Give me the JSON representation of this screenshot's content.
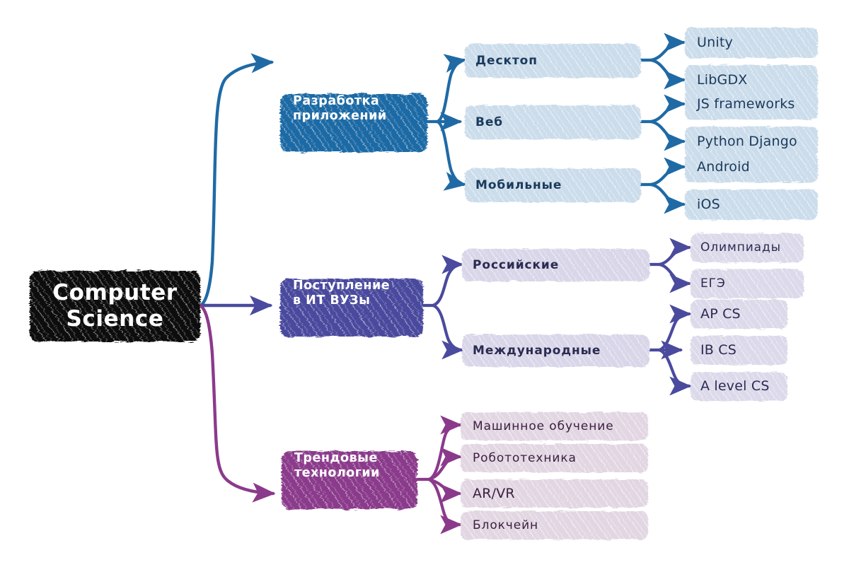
{
  "diagram": {
    "title": "Computer Science",
    "type": "mind-map",
    "background": "#ffffff",
    "colors": {
      "root_fill": "#0d0d0d",
      "root_text": "#ffffff",
      "blue_branch": "#1f6aa5",
      "blue_mid_fill": "#cbdceb",
      "blue_leaf_fill": "#cbdceb",
      "blue_text": "#1b3a5c",
      "purple_branch": "#4a4a9e",
      "purple_mid_fill": "#d8d6e8",
      "purple_leaf_fill": "#dcd9ea",
      "purple_text": "#2b2b52",
      "plum_branch": "#8b3a8b",
      "plum_leaf_fill": "#e2d6e2",
      "plum_text": "#3d2040"
    }
  },
  "root": {
    "line1": "Computer",
    "line2": "Science"
  },
  "branches": [
    {
      "id": "app-development",
      "line1": "Разработка",
      "line2": "приложений",
      "color": "#1f6aa5",
      "children": [
        {
          "id": "desktop",
          "label": "Десктоп",
          "leaves": [
            {
              "id": "unity",
              "label": "Unity"
            },
            {
              "id": "libgdx",
              "label": "LibGDX"
            }
          ]
        },
        {
          "id": "web",
          "label": "Веб",
          "leaves": [
            {
              "id": "js-frameworks",
              "label": "JS frameworks"
            },
            {
              "id": "python-django",
              "label": "Python Django"
            }
          ]
        },
        {
          "id": "mobile",
          "label": "Мобильные",
          "leaves": [
            {
              "id": "android",
              "label": "Android"
            },
            {
              "id": "ios",
              "label": "iOS"
            }
          ]
        }
      ]
    },
    {
      "id": "it-university-admission",
      "line1": "Поступление",
      "line2": "в ИТ ВУЗы",
      "color": "#4a4a9e",
      "children": [
        {
          "id": "russian",
          "label": "Российские",
          "leaves": [
            {
              "id": "olympiads",
              "label": "Олимпиады"
            },
            {
              "id": "ege",
              "label": "ЕГЭ"
            }
          ]
        },
        {
          "id": "international",
          "label": "Международные",
          "leaves": [
            {
              "id": "ap-cs",
              "label": "AP CS"
            },
            {
              "id": "ib-cs",
              "label": "IB CS"
            },
            {
              "id": "a-level-cs",
              "label": "A level CS"
            }
          ]
        }
      ]
    },
    {
      "id": "trending-technologies",
      "line1": "Трендовые",
      "line2": "технологии",
      "color": "#8b3a8b",
      "children": [
        {
          "id": "machine-learning",
          "label": "Машинное обучение"
        },
        {
          "id": "robotics",
          "label": "Робототехника"
        },
        {
          "id": "ar-vr",
          "label": "AR/VR"
        },
        {
          "id": "blockchain",
          "label": "Блокчейн"
        }
      ]
    }
  ]
}
